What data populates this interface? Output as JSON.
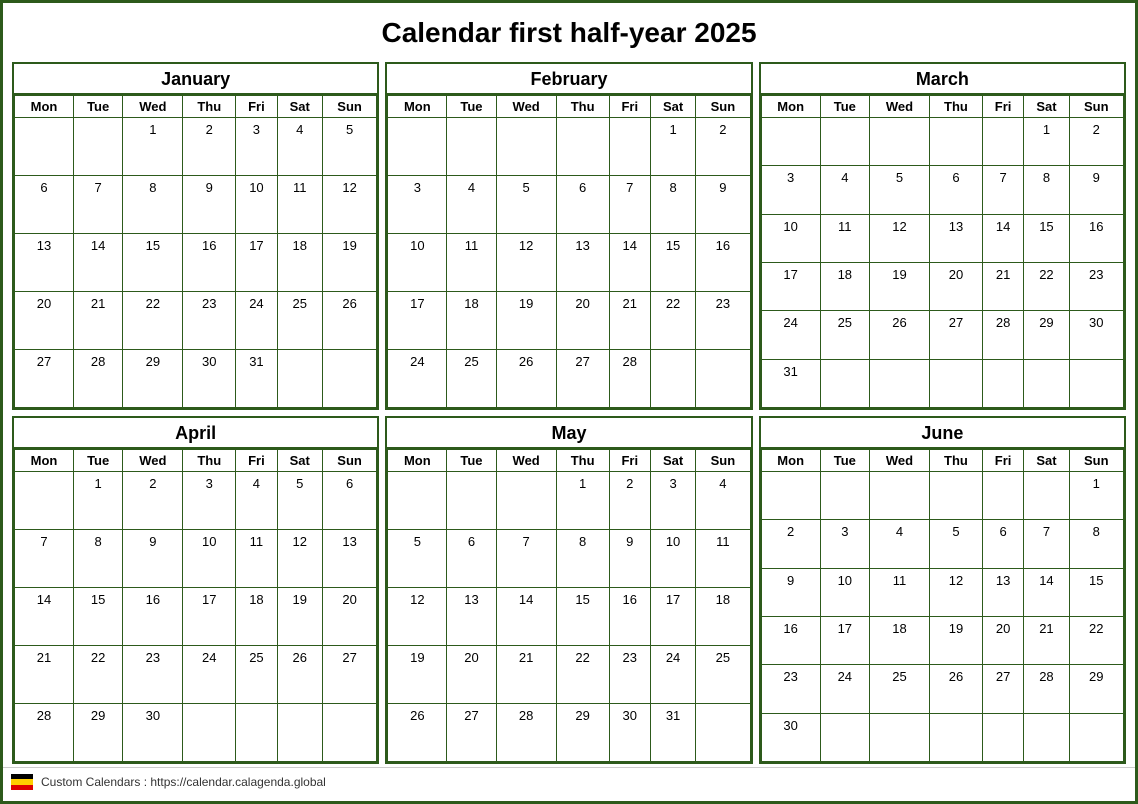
{
  "title": "Calendar first half-year 2025",
  "days_header": [
    "Mon",
    "Tue",
    "Wed",
    "Thu",
    "Fri",
    "Sat",
    "Sun"
  ],
  "months": [
    {
      "name": "January",
      "weeks": [
        [
          "",
          "",
          "1",
          "2",
          "3",
          "4",
          "5"
        ],
        [
          "6",
          "7",
          "8",
          "9",
          "10",
          "11",
          "12"
        ],
        [
          "13",
          "14",
          "15",
          "16",
          "17",
          "18",
          "19"
        ],
        [
          "20",
          "21",
          "22",
          "23",
          "24",
          "25",
          "26"
        ],
        [
          "27",
          "28",
          "29",
          "30",
          "31",
          "",
          ""
        ]
      ]
    },
    {
      "name": "February",
      "weeks": [
        [
          "",
          "",
          "",
          "",
          "",
          "1",
          "2"
        ],
        [
          "3",
          "4",
          "5",
          "6",
          "7",
          "8",
          "9"
        ],
        [
          "10",
          "11",
          "12",
          "13",
          "14",
          "15",
          "16"
        ],
        [
          "17",
          "18",
          "19",
          "20",
          "21",
          "22",
          "23"
        ],
        [
          "24",
          "25",
          "26",
          "27",
          "28",
          "",
          ""
        ]
      ]
    },
    {
      "name": "March",
      "weeks": [
        [
          "",
          "",
          "",
          "",
          "",
          "1",
          "2"
        ],
        [
          "3",
          "4",
          "5",
          "6",
          "7",
          "8",
          "9"
        ],
        [
          "10",
          "11",
          "12",
          "13",
          "14",
          "15",
          "16"
        ],
        [
          "17",
          "18",
          "19",
          "20",
          "21",
          "22",
          "23"
        ],
        [
          "24",
          "25",
          "26",
          "27",
          "28",
          "29",
          "30"
        ],
        [
          "31",
          "",
          "",
          "",
          "",
          "",
          ""
        ]
      ]
    },
    {
      "name": "April",
      "weeks": [
        [
          "",
          "1",
          "2",
          "3",
          "4",
          "5",
          "6"
        ],
        [
          "7",
          "8",
          "9",
          "10",
          "11",
          "12",
          "13"
        ],
        [
          "14",
          "15",
          "16",
          "17",
          "18",
          "19",
          "20"
        ],
        [
          "21",
          "22",
          "23",
          "24",
          "25",
          "26",
          "27"
        ],
        [
          "28",
          "29",
          "30",
          "",
          "",
          "",
          ""
        ]
      ]
    },
    {
      "name": "May",
      "weeks": [
        [
          "",
          "",
          "",
          "1",
          "2",
          "3",
          "4"
        ],
        [
          "5",
          "6",
          "7",
          "8",
          "9",
          "10",
          "11"
        ],
        [
          "12",
          "13",
          "14",
          "15",
          "16",
          "17",
          "18"
        ],
        [
          "19",
          "20",
          "21",
          "22",
          "23",
          "24",
          "25"
        ],
        [
          "26",
          "27",
          "28",
          "29",
          "30",
          "31",
          ""
        ]
      ]
    },
    {
      "name": "June",
      "weeks": [
        [
          "",
          "",
          "",
          "",
          "",
          "",
          "1"
        ],
        [
          "2",
          "3",
          "4",
          "5",
          "6",
          "7",
          "8"
        ],
        [
          "9",
          "10",
          "11",
          "12",
          "13",
          "14",
          "15"
        ],
        [
          "16",
          "17",
          "18",
          "19",
          "20",
          "21",
          "22"
        ],
        [
          "23",
          "24",
          "25",
          "26",
          "27",
          "28",
          "29"
        ],
        [
          "30",
          "",
          "",
          "",
          "",
          "",
          ""
        ]
      ]
    }
  ],
  "footer": {
    "text": "Custom Calendars : https://calendar.calagenda.global"
  }
}
